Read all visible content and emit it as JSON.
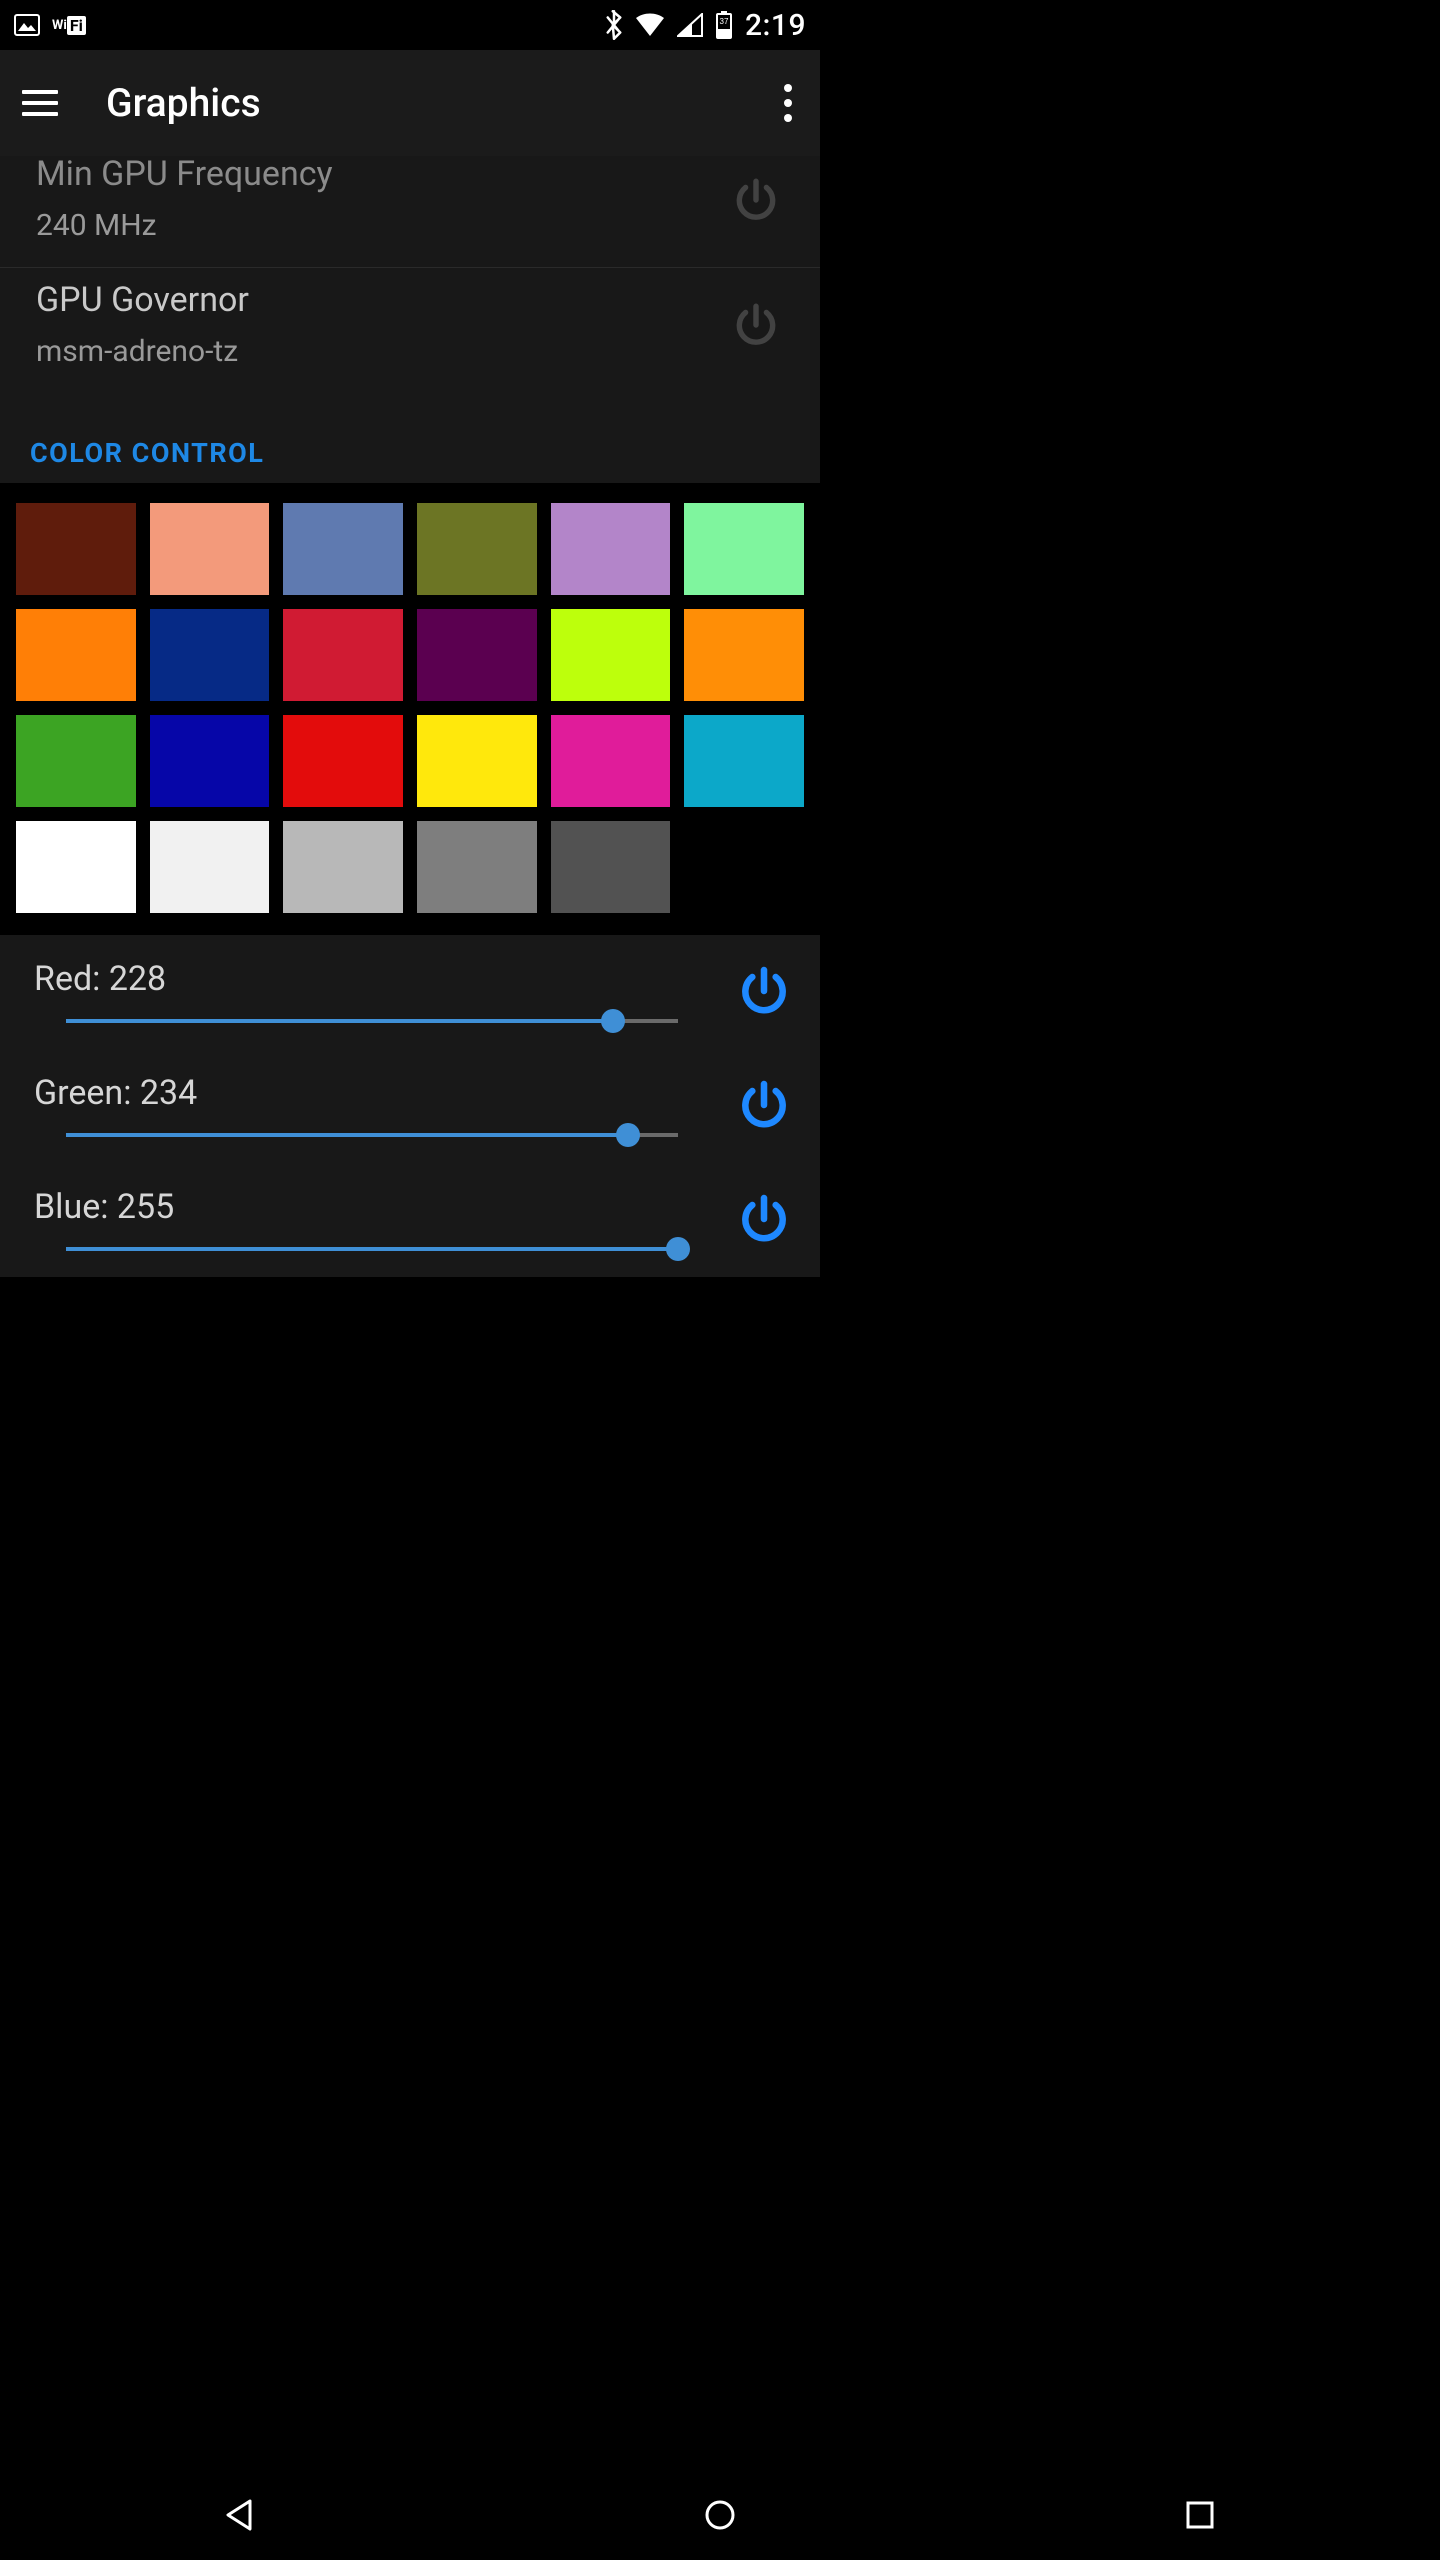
{
  "status_bar": {
    "time": "2:19",
    "battery_level": "37"
  },
  "app_bar": {
    "title": "Graphics"
  },
  "settings": {
    "min_gpu_freq": {
      "title": "Min GPU Frequency",
      "value": "240 MHz"
    },
    "gpu_governor": {
      "title": "GPU Governor",
      "value": "msm-adreno-tz"
    }
  },
  "section": {
    "color_control": "COLOR CONTROL"
  },
  "color_checker": {
    "swatches": [
      "#5f1c0c",
      "#f39a7b",
      "#5f7ab0",
      "#6c7524",
      "#b385c9",
      "#7ff59e",
      "#ff7f06",
      "#062a86",
      "#d01b33",
      "#5b0050",
      "#bdff0c",
      "#ff8e06",
      "#3ca423",
      "#0606a8",
      "#e30c0c",
      "#ffe80c",
      "#e01c9a",
      "#0ca8c9",
      "#ffffff",
      "#f1f1f1",
      "#b8b8b8",
      "#7e7e7e",
      "#525252",
      "#000000"
    ]
  },
  "sliders": {
    "red": {
      "label": "Red: 228",
      "value": 228,
      "max": 255
    },
    "green": {
      "label": "Green: 234",
      "value": 234,
      "max": 255
    },
    "blue": {
      "label": "Blue: 255",
      "value": 255,
      "max": 255
    }
  },
  "accent_color": "#1e88e5"
}
